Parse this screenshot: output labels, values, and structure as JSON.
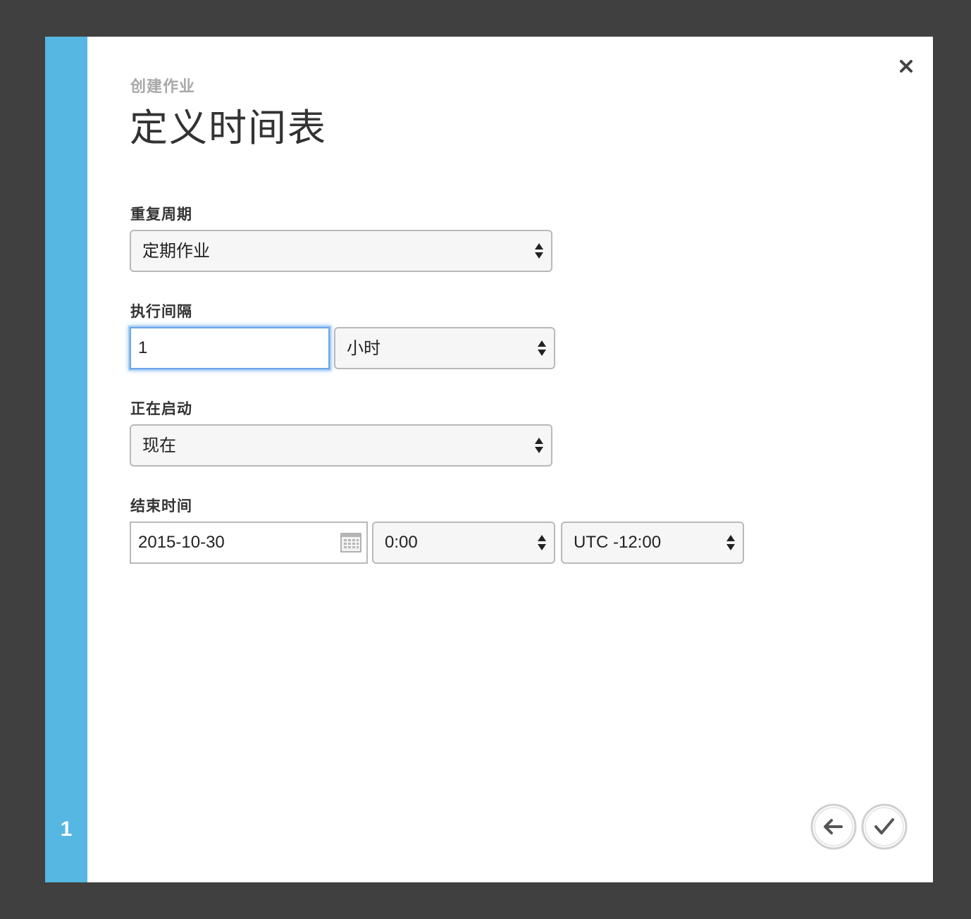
{
  "wizard": {
    "subtitle": "创建作业",
    "title": "定义时间表",
    "step": "1"
  },
  "recurrence": {
    "label": "重复周期",
    "value": "定期作业"
  },
  "interval": {
    "label": "执行间隔",
    "value": "1",
    "unit": "小时"
  },
  "start": {
    "label": "正在启动",
    "value": "现在"
  },
  "end": {
    "label": "结束时间",
    "date": "2015-10-30",
    "time": "0:00",
    "timezone": "UTC -12:00"
  },
  "icons": {
    "close": "close-icon",
    "calendar": "calendar-icon",
    "back": "arrow-left-icon",
    "finish": "checkmark-icon",
    "dropdown": "updown-arrows-icon"
  },
  "colors": {
    "background": "#404040",
    "accent": "#56b7e2",
    "focus": "#6aa5e8"
  }
}
